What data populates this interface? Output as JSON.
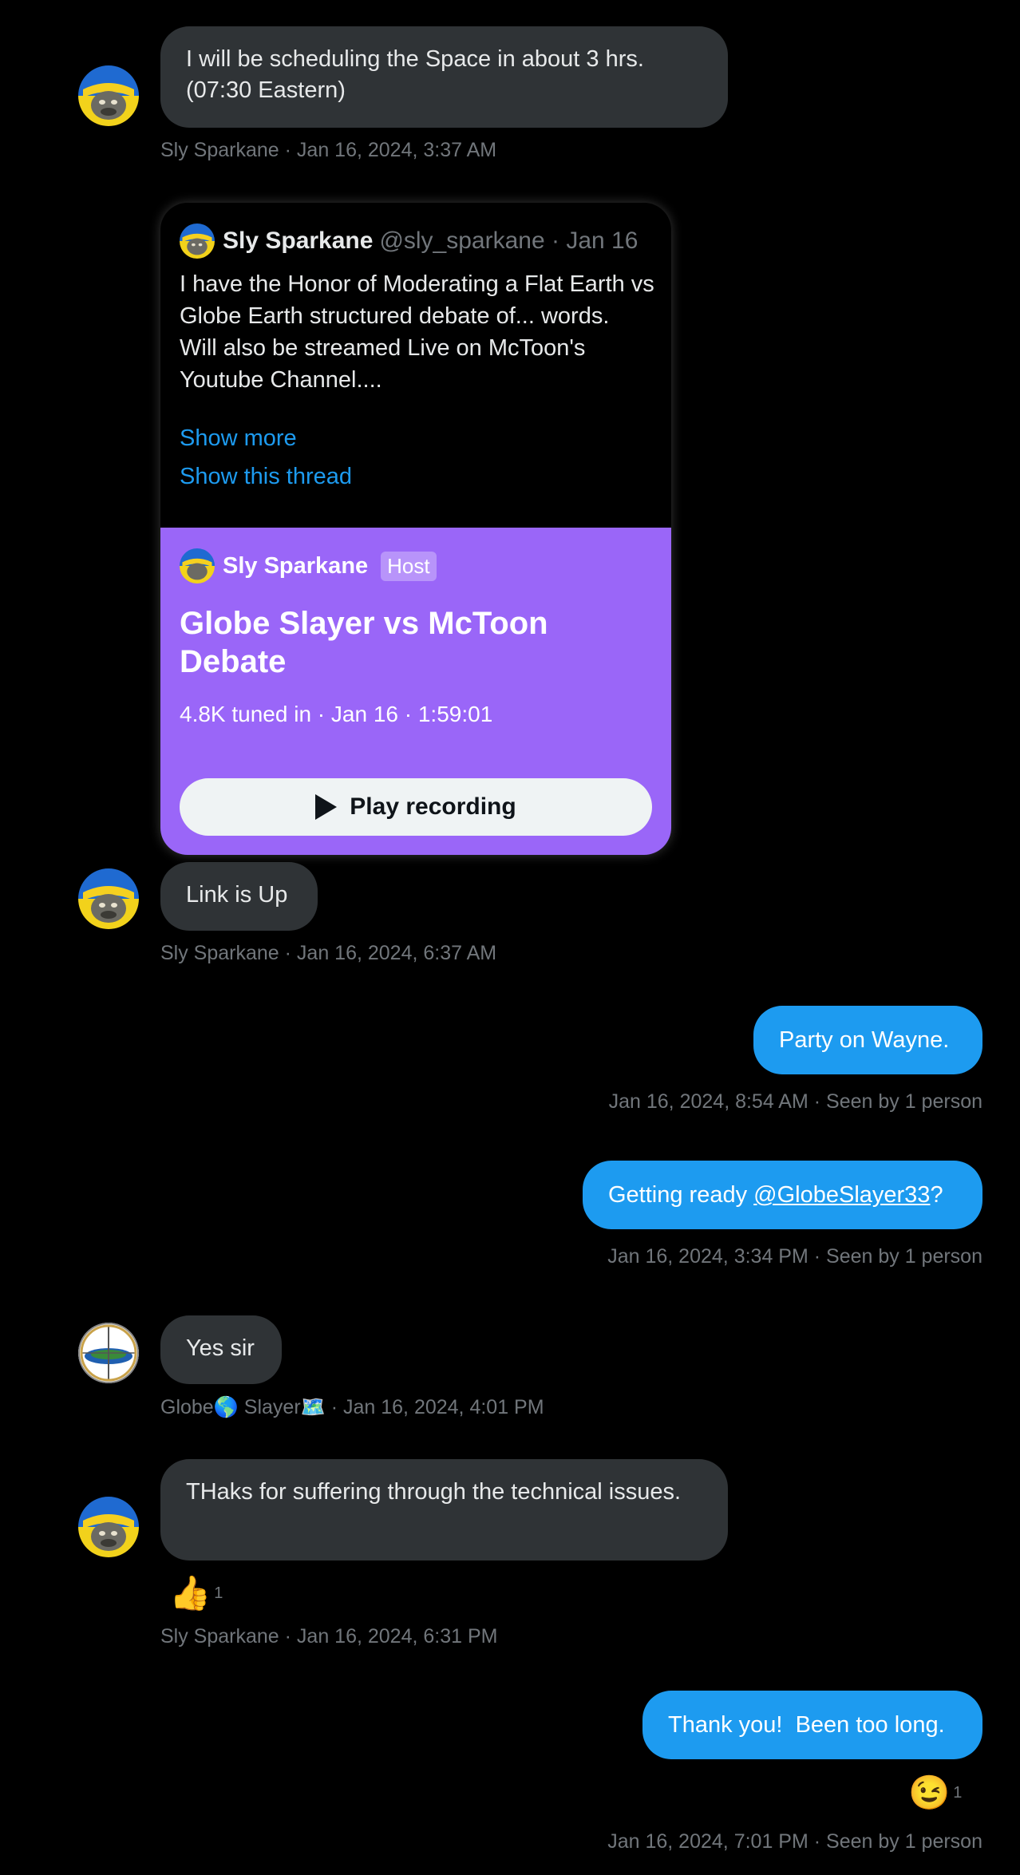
{
  "messages": {
    "m1": {
      "text": "I will be scheduling the Space in about 3 hrs. (07:30 Eastern)",
      "meta": "Sly Sparkane · Jan 16, 2024, 3:37 AM"
    },
    "card": {
      "author_name": "Sly Sparkane",
      "author_handle": "@sly_sparkane · Jan 16",
      "text": "I have the Honor of Moderating a Flat Earth vs Globe Earth structured debate of... words.\nWill also be streamed Live on McToon's Youtube Channel....",
      "show_more": "Show more",
      "show_thread": "Show this thread",
      "space": {
        "host_name": "Sly Sparkane",
        "host_badge": "Host",
        "title": "Globe Slayer vs McToon Debate",
        "stats": "4.8K tuned in · Jan 16 · 1:59:01",
        "play_label": "Play recording",
        "background": "#9a66f8"
      }
    },
    "m2": {
      "text": "Link is Up",
      "meta": "Sly Sparkane · Jan 16, 2024, 6:37 AM"
    },
    "m3": {
      "text": "Party on Wayne.",
      "meta": "Jan 16, 2024, 8:54 AM · Seen by 1 person"
    },
    "m4": {
      "text_before": "Getting ready ",
      "mention": "@GlobeSlayer33",
      "text_after": "?",
      "meta": "Jan 16, 2024, 3:34 PM · Seen by 1 person"
    },
    "m5": {
      "text": "Yes sir",
      "meta": "Globe🌎 Slayer🗺️ · Jan 16, 2024, 4:01 PM"
    },
    "m6": {
      "text": "THaks for suffering through the technical issues.",
      "reaction_emoji": "👍",
      "reaction_count": "1",
      "meta": "Sly Sparkane · Jan 16, 2024, 6:31 PM"
    },
    "m7": {
      "text": "Thank you!  Been too long.",
      "reaction_emoji": "😉",
      "reaction_count": "1",
      "meta": "Jan 16, 2024, 7:01 PM · Seen by 1 person"
    }
  },
  "colors": {
    "incoming_bubble": "#2f3336",
    "outgoing_bubble": "#1d9bf0",
    "meta_text": "#71767b",
    "link": "#1d9bf0"
  },
  "icons": {
    "avatar_sly": "sly-sparkane-avatar",
    "avatar_globe": "globe-slayer-avatar",
    "play": "play-icon"
  }
}
